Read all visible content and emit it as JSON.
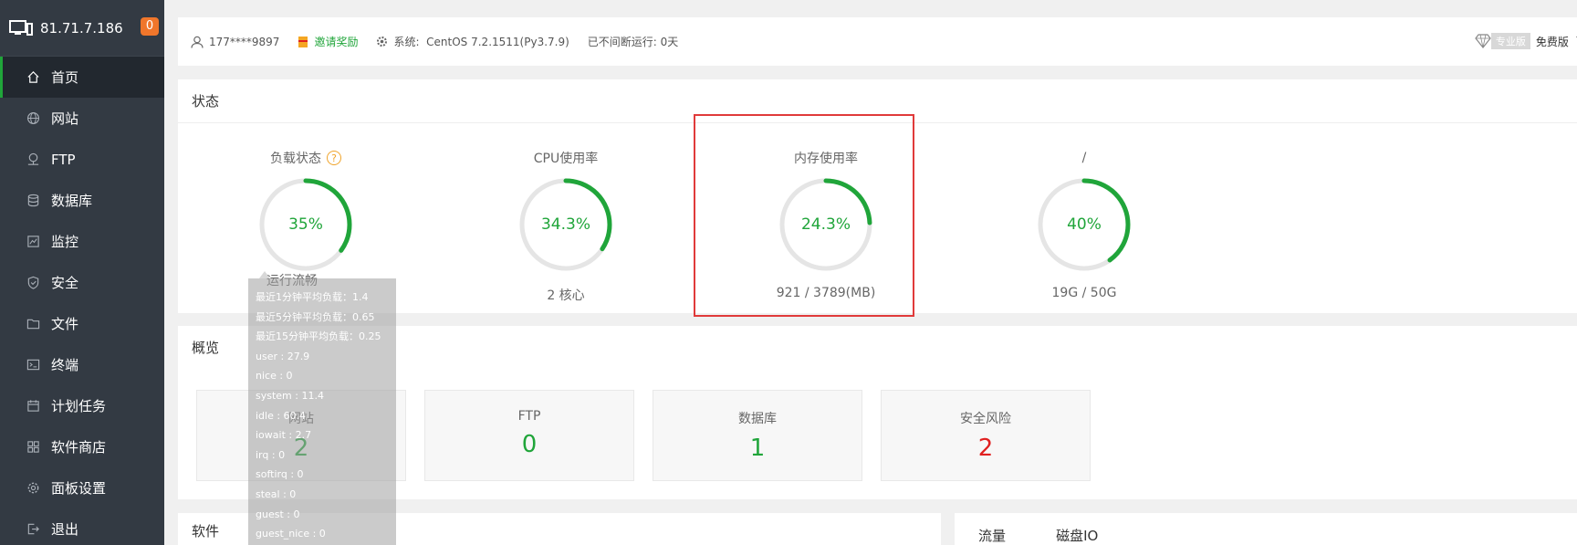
{
  "sidebar": {
    "host": "81.71.7.186",
    "badge": "0",
    "items": [
      {
        "label": "首页",
        "icon": "home-icon"
      },
      {
        "label": "网站",
        "icon": "globe-icon"
      },
      {
        "label": "FTP",
        "icon": "ftp-icon"
      },
      {
        "label": "数据库",
        "icon": "database-icon"
      },
      {
        "label": "监控",
        "icon": "monitor-icon"
      },
      {
        "label": "安全",
        "icon": "shield-icon"
      },
      {
        "label": "文件",
        "icon": "folder-icon"
      },
      {
        "label": "终端",
        "icon": "terminal-icon"
      },
      {
        "label": "计划任务",
        "icon": "calendar-icon"
      },
      {
        "label": "软件商店",
        "icon": "apps-icon"
      },
      {
        "label": "面板设置",
        "icon": "gear-icon"
      },
      {
        "label": "退出",
        "icon": "logout-icon"
      }
    ]
  },
  "topbar": {
    "user": "177****9897",
    "invite": "邀请奖励",
    "system_label": "系统:",
    "system_value": "CentOS 7.2.1511(Py3.7.9)",
    "uptime": "已不间断运行: 0天",
    "pro_tag": "专业版",
    "edition": "免费版",
    "version_prefix": "7."
  },
  "status": {
    "title": "状态",
    "gauges": [
      {
        "label": "负载状态",
        "value": "35%",
        "percent": 35,
        "sub": "运行流畅",
        "has_help": true
      },
      {
        "label": "CPU使用率",
        "value": "34.3%",
        "percent": 34.3,
        "sub": "2 核心"
      },
      {
        "label": "内存使用率",
        "value": "24.3%",
        "percent": 24.3,
        "sub": "921 / 3789(MB)"
      },
      {
        "label": "/",
        "value": "40%",
        "percent": 40,
        "sub": "19G / 50G"
      }
    ],
    "help_mark": "?"
  },
  "tooltip": {
    "lines": [
      "最近1分钟平均负载：1.4",
      "最近5分钟平均负载：0.65",
      "最近15分钟平均负载：0.25",
      "user : 27.9",
      "nice : 0",
      "system : 11.4",
      "idle : 60.4",
      "iowait : 2.7",
      "irq : 0",
      "softirq : 0",
      "steal : 0",
      "guest : 0",
      "guest_nice : 0"
    ]
  },
  "overview": {
    "title": "概览",
    "cards": [
      {
        "label": "网站",
        "value": "2"
      },
      {
        "label": "FTP",
        "value": "0"
      },
      {
        "label": "数据库",
        "value": "1"
      },
      {
        "label": "安全风险",
        "value": "2",
        "danger": true
      }
    ]
  },
  "software": {
    "title": "软件"
  },
  "flow": {
    "tabs": [
      "流量",
      "磁盘IO"
    ]
  },
  "colors": {
    "accent": "#20a53a",
    "danger": "#e02020",
    "sidebar": "#333a43",
    "highlight": "#e03a3a"
  }
}
